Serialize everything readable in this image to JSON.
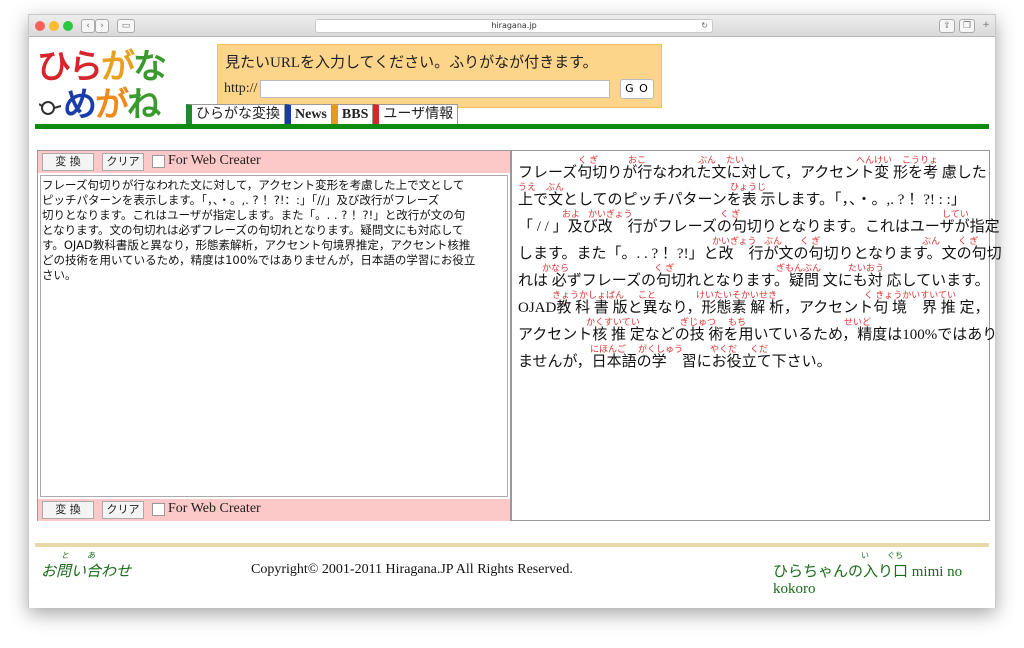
{
  "browser": {
    "url": "hiragana.jp"
  },
  "logo": {
    "line1": "ひらがな",
    "line2": "めがね",
    "colors": [
      "#d6252b",
      "#e8a11f",
      "#f08a1a",
      "#3a9a2d"
    ]
  },
  "header": {
    "message": "見たいURLを入力してください。ふりがなが付きます。",
    "http_label": "http://",
    "url_value": "",
    "go_label": "G O"
  },
  "nav": {
    "tabs": [
      {
        "label": "ひらがな変換",
        "color": "#1c8b2e"
      },
      {
        "label": "News",
        "color": "#1a3ca8"
      },
      {
        "label": "BBS",
        "color": "#e29b1d"
      },
      {
        "label": "ユーザ情報",
        "color": "#d6252b"
      }
    ]
  },
  "left_panel": {
    "convert_label": "変 換",
    "clear_label": "クリア",
    "web_creator_label": "For Web Creater",
    "source_lines": [
      "フレーズ句切りが行なわれた文に対して，アクセント変形を考慮した上で文として",
      "ピッチパターンを表示します。「，、・。,. ? ！?!：:」「//」及び改行がフレーズ",
      "切りとなります。これはユーザが指定します。また「。. . ? ！?!」と改行が文の句",
      "となります。文の句切れは必ずフレーズの句切れとなります。疑問文にも対応して",
      "す。OJAD教科書版と異なり，形態素解析，アクセント句境界推定，アクセント核推",
      "どの技術を用いているため，精度は100%ではありませんが，日本語の学習にお役立",
      "さい。"
    ]
  },
  "right_panel": {
    "lines": [
      {
        "text": "フレーズ句切りが行なわれた文に対して，アクセント変 形を考 慮した",
        "ruby": [
          {
            "t": "く ぎ",
            "at": 60
          },
          {
            "t": "おこ",
            "at": 110
          },
          {
            "t": "ぶん",
            "at": 180
          },
          {
            "t": "たい",
            "at": 208
          },
          {
            "t": "へんけい",
            "at": 338
          },
          {
            "t": "こうりょ",
            "at": 384
          }
        ]
      },
      {
        "text": " 上で文としてのピッチパターンを表 示します。「，、・。,. ? ！?! : :」",
        "ruby": [
          {
            "t": "うえ",
            "at": 0
          },
          {
            "t": "ぶん",
            "at": 28
          },
          {
            "t": "ひょうじ",
            "at": 212
          }
        ]
      },
      {
        "text": "「 / / 」及び改　行がフレーズの句切りとなります。これはユーザが指定",
        "ruby": [
          {
            "t": "およ",
            "at": 44
          },
          {
            "t": "かいぎょう",
            "at": 70
          },
          {
            "t": "く ぎ",
            "at": 202
          },
          {
            "t": "してい",
            "at": 424
          }
        ]
      },
      {
        "text": "します。また「。. . ? ！?!」と改　行が文の句切りとなります。文の句切",
        "ruby": [
          {
            "t": "かいぎょう",
            "at": 194
          },
          {
            "t": "ぶん",
            "at": 246
          },
          {
            "t": "く ぎ",
            "at": 282
          },
          {
            "t": "ぶん",
            "at": 404
          },
          {
            "t": "く ぎ",
            "at": 440
          }
        ]
      },
      {
        "text": "れは 必ずフレーズの句切れとなります。疑問 文にも対 応しています。",
        "ruby": [
          {
            "t": "かなら",
            "at": 24
          },
          {
            "t": "く ぎ",
            "at": 136
          },
          {
            "t": "ぎもんぶん",
            "at": 258
          },
          {
            "t": "たいおう",
            "at": 330
          }
        ]
      },
      {
        "text": "OJAD教 科 書 版と異なり，形態素 解 析，アクセント句 境　界 推 定，",
        "ruby": [
          {
            "t": "きょうかしょばん",
            "at": 34
          },
          {
            "t": "こと",
            "at": 120
          },
          {
            "t": "けいたいそかいせき",
            "at": 178
          },
          {
            "t": "く きょうかいすいてい",
            "at": 346
          }
        ]
      },
      {
        "text": "アクセント核 推 定などの技 術を用いているため，精度は100%ではあり",
        "ruby": [
          {
            "t": "かくすいてい",
            "at": 68
          },
          {
            "t": "ぎじゅつ",
            "at": 162
          },
          {
            "t": "もち",
            "at": 210
          },
          {
            "t": "せいど",
            "at": 326
          }
        ]
      },
      {
        "text": "ませんが，日本語の学　習にお役立て下さい。",
        "ruby": [
          {
            "t": "にほんご",
            "at": 72
          },
          {
            "t": "がくしゅう",
            "at": 120
          },
          {
            "t": "やくだ",
            "at": 192
          },
          {
            "t": "くだ",
            "at": 232
          }
        ]
      }
    ]
  },
  "footer": {
    "contact": "お問い合わせ",
    "contact_ruby_1": "と",
    "contact_ruby_2": "あ",
    "copyright": "Copyright© 2001-2011 Hiragana.JP All Rights Reserved.",
    "entrance": "ひらちゃんの入り口 mimi no kokoro",
    "entrance_ruby_1": "い",
    "entrance_ruby_2": "ぐち"
  }
}
